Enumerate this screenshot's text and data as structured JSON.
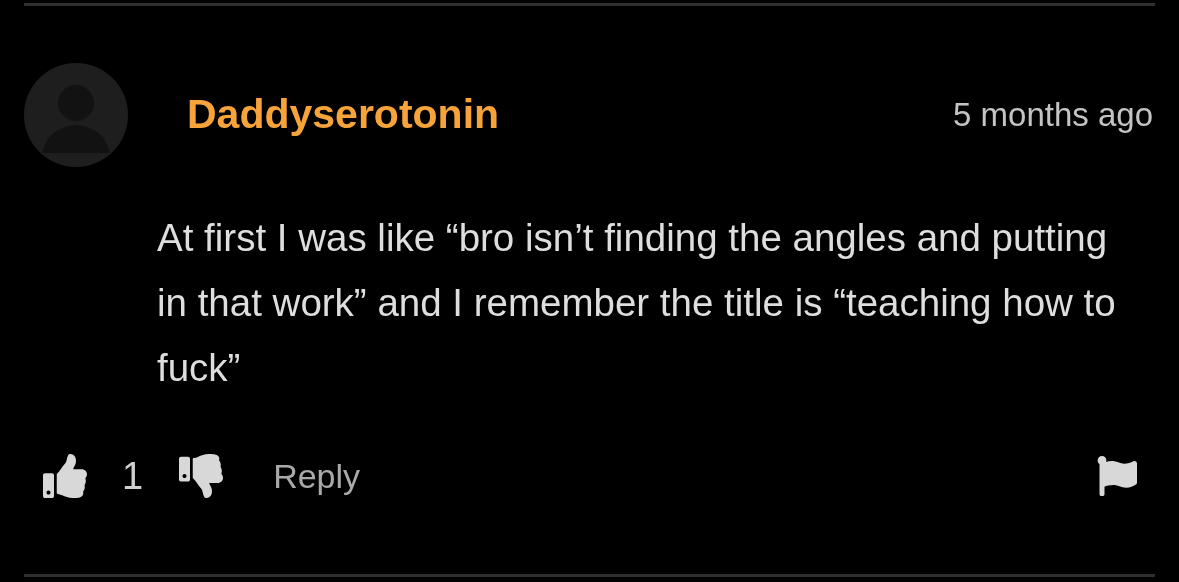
{
  "comment": {
    "author": "Daddyserotonin",
    "time": "5 months ago",
    "text": "At first I was like “bro isn’t finding the angles and putting in that work” and I remember the title is “teaching how to fuck”",
    "likes": "1",
    "reply": "Reply"
  }
}
